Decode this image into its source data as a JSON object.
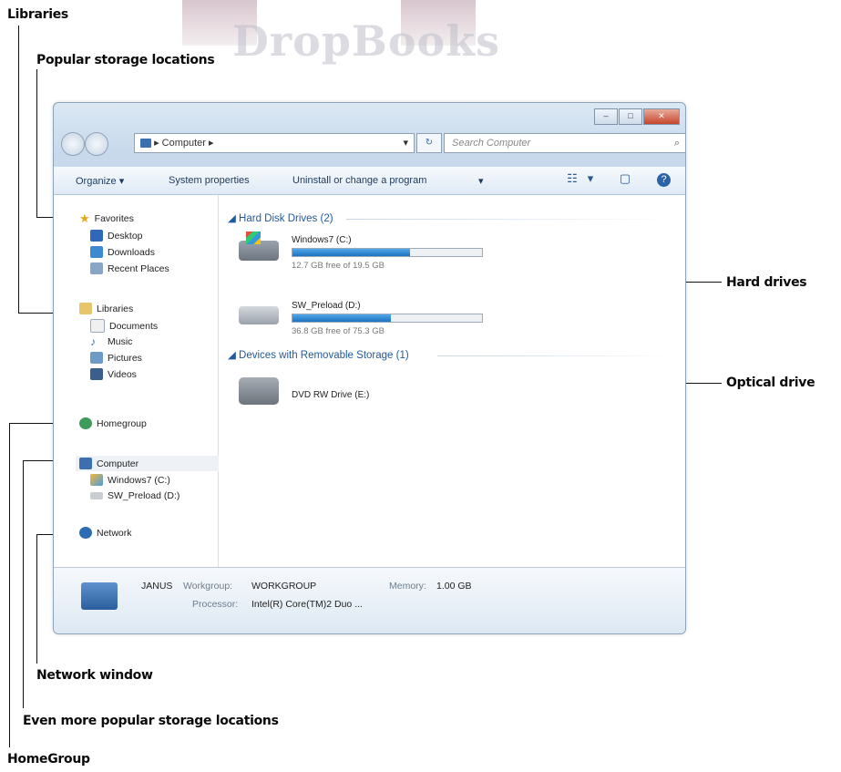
{
  "watermark": "DropBooks",
  "callouts": {
    "libraries": "Libraries",
    "popular": "Popular storage locations",
    "hard_drives": "Hard drives",
    "optical": "Optical drive",
    "network": "Network window",
    "even_more": "Even more popular storage locations",
    "homegroup": "HomeGroup"
  },
  "window": {
    "caption": [
      "–",
      "□",
      "✕"
    ],
    "address_path": "Computer ▸",
    "address_prefix": "▸",
    "address_drop": "▾",
    "refresh": "↻",
    "search_placeholder": "Search Computer",
    "search_icon": "⌕",
    "toolbar": {
      "organize": "Organize ▾",
      "system_properties": "System properties",
      "uninstall": "Uninstall or change a program",
      "more": "▾"
    },
    "nav": {
      "favorites": "Favorites",
      "desktop": "Desktop",
      "downloads": "Downloads",
      "recent": "Recent Places",
      "libraries": "Libraries",
      "documents": "Documents",
      "music": "Music",
      "pictures": "Pictures",
      "videos": "Videos",
      "homegroup": "Homegroup",
      "computer": "Computer",
      "drive_c": "Windows7 (C:)",
      "drive_d": "SW_Preload (D:)",
      "network": "Network"
    },
    "groups": {
      "hard_disk": "◢ Hard Disk Drives (2)",
      "removable": "◢ Devices with Removable Storage (1)"
    },
    "drives": [
      {
        "name": "Windows7 (C:)",
        "free": "12.7 GB free of 19.5 GB",
        "used_fraction": 0.62
      },
      {
        "name": "SW_Preload (D:)",
        "free": "36.8 GB free of 75.3 GB",
        "used_fraction": 0.52
      }
    ],
    "dvd": {
      "name": "DVD RW Drive (E:)"
    },
    "details": {
      "computer_name": "JANUS",
      "workgroup_label": "Workgroup:",
      "workgroup": "WORKGROUP",
      "memory_label": "Memory:",
      "memory": "1.00 GB",
      "processor_label": "Processor:",
      "processor": "Intel(R) Core(TM)2 Duo ..."
    }
  }
}
